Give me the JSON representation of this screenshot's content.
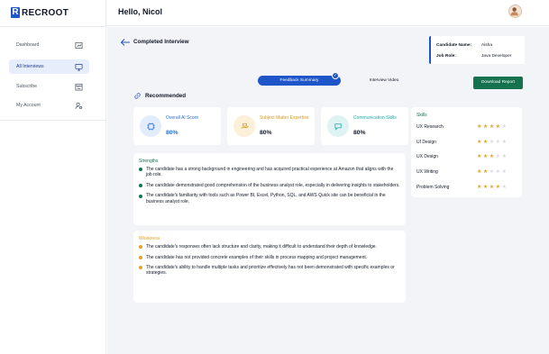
{
  "app": {
    "logo_letter": "R",
    "logo_text": "RECROOT",
    "brand_color": "#1e55c8"
  },
  "sidebar": {
    "items": [
      {
        "label": "Dashboard",
        "icon": "chart-icon",
        "active": false
      },
      {
        "label": "All Interviews",
        "icon": "monitor-icon",
        "active": true
      },
      {
        "label": "Subscribe",
        "icon": "calendar-icon",
        "active": false
      },
      {
        "label": "My Account",
        "icon": "user-settings-icon",
        "active": false
      }
    ]
  },
  "header": {
    "greeting": "Hello, Nicol",
    "avatar_icon": "user-avatar-icon"
  },
  "page": {
    "title": "Completed Interview",
    "back_icon": "arrow-left-icon"
  },
  "candidate": {
    "name_label": "Candidate Name:",
    "name_value": "Aisha",
    "role_label": "Job Role:",
    "role_value": "Java Developer"
  },
  "tabs": {
    "active": "Feedback Summary",
    "inactive": "Interview Video"
  },
  "actions": {
    "download": "Download Report"
  },
  "recommended": {
    "heading": "Recommended",
    "icon": "link-icon"
  },
  "stats": [
    {
      "label": "Overall AI Score",
      "value": "80%",
      "color": "#2a6fd6",
      "bg": "#e3ecfb",
      "icon": "ai-chip-icon"
    },
    {
      "label": "Subject Matter Expertise",
      "value": "80%",
      "color": "#d99a1c",
      "bg": "#fcf0d8",
      "icon": "book-hand-icon"
    },
    {
      "label": "Communication Skills",
      "value": "80%",
      "color": "#2aa6a6",
      "bg": "#dff3f3",
      "icon": "speech-icon"
    }
  ],
  "skills": {
    "title": "Skills",
    "max_stars": 5,
    "items": [
      {
        "name": "UX Research",
        "rating": 4
      },
      {
        "name": "UI Design",
        "rating": 2
      },
      {
        "name": "UX Design",
        "rating": 3
      },
      {
        "name": "UX Writing",
        "rating": 2
      },
      {
        "name": "Problem Solving",
        "rating": 4
      }
    ]
  },
  "strengths": {
    "title": "Strengths",
    "color": "#15724e",
    "items": [
      "The candidate has a strong background in engineering and has acquired practical experience at Amazon that aligns with the job role.",
      "The candidate demonstrated good comprehension of the business analyst role, especially in delivering insights to stakeholders.",
      "The candidate's familiarity with tools such as Power BI, Excel, Python, SQL, and AWS Quick site can be beneficial in the business analyst role."
    ]
  },
  "weakness": {
    "title": "Weakness",
    "color": "#e0a52a",
    "items": [
      "The candidate's responses often lack structure and clarity, making it difficult to understand their depth of knowledge.",
      "The candidate has not provided concrete examples of their skills in process mapping and project management.",
      "The candidate's ability to handle multiple tasks and prioritize effectively has not been demonstrated with specific examples or strategies."
    ]
  }
}
